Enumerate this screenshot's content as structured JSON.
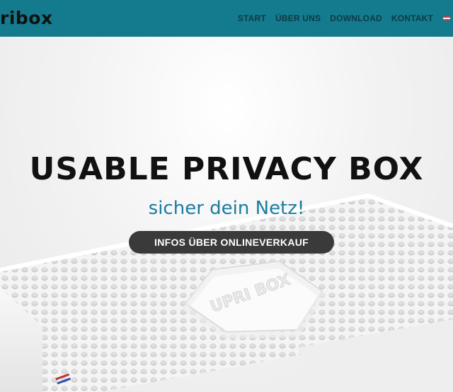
{
  "header": {
    "brand": "ribox",
    "nav": [
      "START",
      "ÜBER UNS",
      "DOWNLOAD",
      "KONTAKT"
    ],
    "language_flag": "austria-flag-icon"
  },
  "hero": {
    "title": "USABLE PRIVACY BOX",
    "subtitle": "sicher dein Netz!",
    "cta_label": "INFOS ÜBER ONLINEVERKAUF",
    "image": "white-3d-printed-box-photo",
    "box_logo_text": "UPRI BOX"
  },
  "colors": {
    "navbar": "#137b8d",
    "nav_text": "#0d3a45",
    "subtitle": "#1a7ca0",
    "button": "#3a3a3a"
  }
}
